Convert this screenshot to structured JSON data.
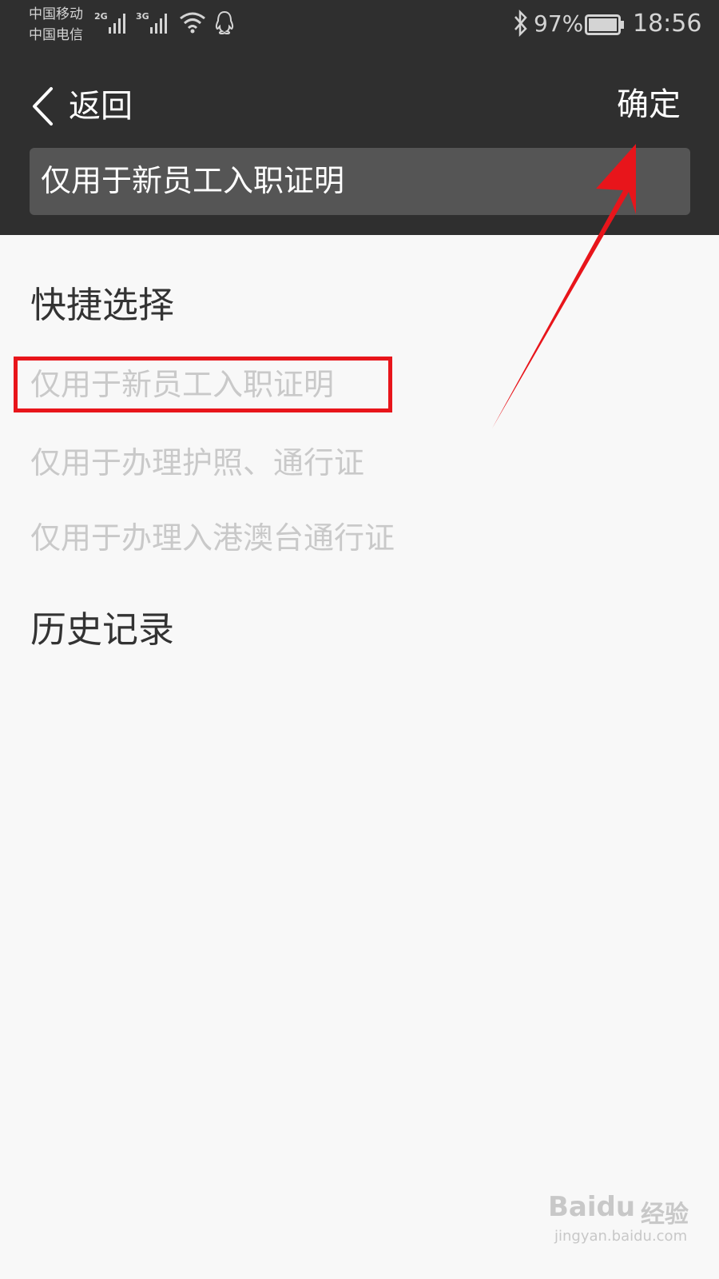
{
  "status_bar": {
    "carrier_1": "中国移动",
    "carrier_2": "中国电信",
    "network_1": "2G",
    "network_2": "3G",
    "battery_percent": "97%",
    "time": "18:56",
    "icons": [
      "signal-icon",
      "signal-icon",
      "wifi-icon",
      "qq-icon",
      "bluetooth-icon",
      "battery-icon"
    ]
  },
  "nav": {
    "back_label": "返回",
    "confirm_label": "确定"
  },
  "input": {
    "value": "仅用于新员工入职证明"
  },
  "quick_select": {
    "title": "快捷选择",
    "items": [
      "仅用于新员工入职证明",
      "仅用于办理护照、通行证",
      "仅用于办理入港澳台通行证"
    ]
  },
  "history": {
    "title": "历史记录"
  },
  "annotations": {
    "highlight_color": "#e8151b",
    "arrow_color": "#e8151b"
  },
  "watermark": {
    "brand": "Baidu",
    "brand_cn": "经验",
    "url": "jingyan.baidu.com"
  },
  "colors": {
    "header_bg": "#2f2f2f",
    "input_bg": "#555555",
    "page_bg": "#f8f8f8",
    "section_title": "#333333",
    "quick_item_text": "#c9c9c9"
  }
}
